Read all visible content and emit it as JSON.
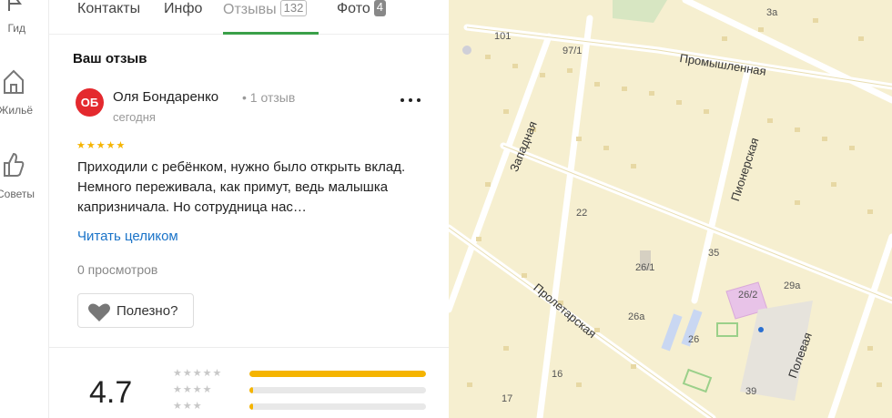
{
  "rail": {
    "items": [
      {
        "label": "Гид",
        "icon": "flag-icon"
      },
      {
        "label": "Жильё",
        "icon": "house-icon"
      },
      {
        "label": "Советы",
        "icon": "thumbs-up-icon"
      }
    ]
  },
  "tabs": [
    {
      "label": "Контакты"
    },
    {
      "label": "Инфо"
    },
    {
      "label": "Отзывы",
      "badge": "132"
    },
    {
      "label": "Фото",
      "badge": "4"
    }
  ],
  "review": {
    "heading": "Ваш отзыв",
    "author_initials": "ОБ",
    "author_name": "Оля Бондаренко",
    "author_meta": "• 1 отзыв",
    "date": "сегодня",
    "stars": "★★★★★",
    "text": "Приходили с ребёнком, нужно было открыть вклад. Немного переживала, как примут, ведь малышка капризничала. Но сотрудница нас…",
    "read_more": "Читать целиком",
    "views": "0 просмотров",
    "useful_label": "Полезно?"
  },
  "rating": {
    "value": "4.7",
    "distribution": [
      {
        "stars": "★★★★★",
        "fraction": 1.0
      },
      {
        "stars": "★★★★",
        "fraction": 0.02
      },
      {
        "stars": "★★★",
        "fraction": 0.02
      }
    ]
  },
  "map": {
    "streets": [
      "Промышленная",
      "Западная",
      "Пионерская",
      "Пролетарская",
      "Полевая"
    ],
    "numbers": [
      "3а",
      "101",
      "97/1",
      "22",
      "35",
      "26/1",
      "26/2",
      "29а",
      "26а",
      "26",
      "16",
      "17",
      "39"
    ]
  },
  "colors": {
    "accent_tab": "#3aa049",
    "star": "#f5b400",
    "link": "#1a73c8",
    "avatar": "#e4292e"
  }
}
